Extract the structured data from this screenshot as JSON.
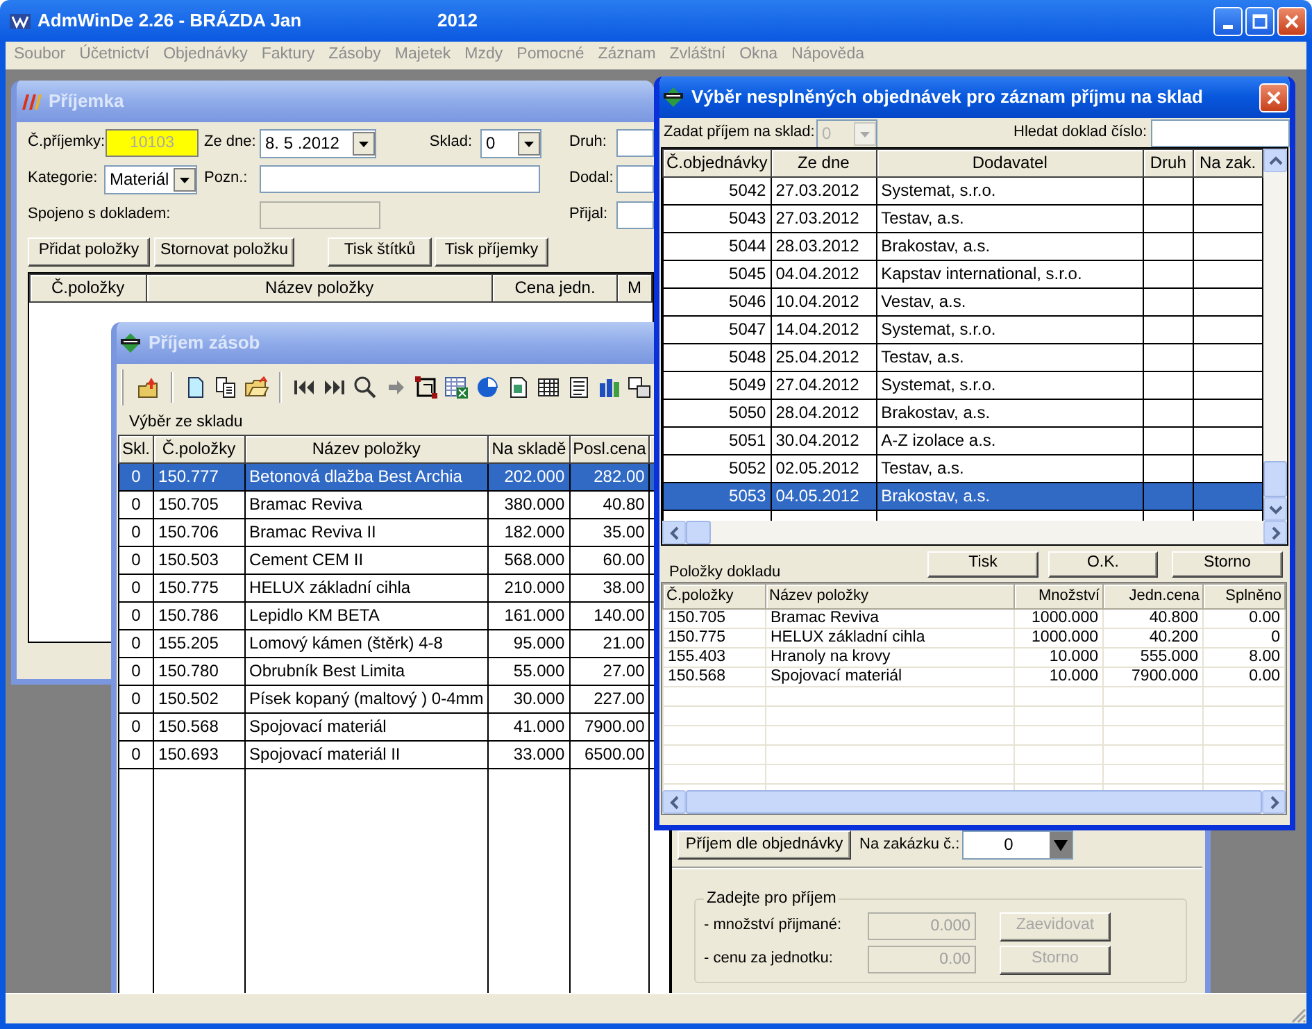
{
  "app_window": {
    "title": "AdmWinDe 2.26 - BRÁZDA Jan",
    "year": "2012"
  },
  "menu": [
    {
      "label": "Soubor",
      "disabled": true
    },
    {
      "label": "Účetnictví",
      "disabled": true
    },
    {
      "label": "Objednávky",
      "disabled": true
    },
    {
      "label": "Faktury",
      "disabled": true
    },
    {
      "label": "Zásoby",
      "disabled": true
    },
    {
      "label": "Majetek",
      "disabled": true
    },
    {
      "label": "Mzdy",
      "disabled": true
    },
    {
      "label": "Pomocné",
      "disabled": true
    },
    {
      "label": "Záznam",
      "disabled": true
    },
    {
      "label": "Zvláštní",
      "disabled": true
    },
    {
      "label": "Okna",
      "disabled": true
    },
    {
      "label": "Nápověda",
      "disabled": true
    }
  ],
  "receipt_window": {
    "title": "Příjemka",
    "active": false,
    "receipt_number": {
      "label": "Č.příjemky:",
      "value": "10103"
    },
    "date": {
      "label": "Ze dne:",
      "value": "8. 5 .2012"
    },
    "warehouse": {
      "label": "Sklad:",
      "value": "0"
    },
    "document_type": {
      "label": "Druh:"
    },
    "category": {
      "label": "Kategorie:",
      "value": "Materiál"
    },
    "note": {
      "label": "Pozn.:"
    },
    "supplier": {
      "label": "Dodal:"
    },
    "linked_document": {
      "label": "Spojeno s dokladem:",
      "disabled": true
    },
    "received_by": {
      "label": "Přijal:"
    },
    "buttons": [
      "Přidat položky",
      "Stornovat položku",
      "Tisk štítků",
      "Tisk příjemky"
    ],
    "table": {
      "columns": [
        "Č.položky",
        "Název položky",
        "Cena jedn.",
        "M"
      ]
    }
  },
  "stock_window": {
    "title": "Příjem zásob",
    "active": false,
    "section_label": "Výběr ze skladu",
    "table": {
      "columns": [
        "Skl.",
        "Č.položky",
        "Název položky",
        "Na skladě",
        "Posl.cena"
      ],
      "rows": [
        {
          "cells": [
            "0",
            "150.777",
            "Betonová dlažba Best Archia",
            "202.000",
            "282.00"
          ],
          "selected": true
        },
        {
          "cells": [
            "0",
            "150.705",
            "Bramac Reviva",
            "380.000",
            "40.80"
          ],
          "selected": false
        },
        {
          "cells": [
            "0",
            "150.706",
            "Bramac Reviva II",
            "182.000",
            "35.00"
          ],
          "selected": false
        },
        {
          "cells": [
            "0",
            "150.503",
            "Cement CEM II",
            "568.000",
            "60.00"
          ],
          "selected": false
        },
        {
          "cells": [
            "0",
            "150.775",
            "HELUX základní cihla",
            "210.000",
            "38.00"
          ],
          "selected": false
        },
        {
          "cells": [
            "0",
            "150.786",
            "Lepidlo KM BETA",
            "161.000",
            "140.00"
          ],
          "selected": false
        },
        {
          "cells": [
            "0",
            "155.205",
            "Lomový kámen (štěrk) 4-8",
            "95.000",
            "21.00"
          ],
          "selected": false
        },
        {
          "cells": [
            "0",
            "150.780",
            "Obrubník Best Limita",
            "55.000",
            "27.00"
          ],
          "selected": false
        },
        {
          "cells": [
            "0",
            "150.502",
            "Písek kopaný (maltový ) 0-4mm",
            "30.000",
            "227.00"
          ],
          "selected": false
        },
        {
          "cells": [
            "0",
            "150.568",
            "Spojovací materiál",
            "41.000",
            "7900.00"
          ],
          "selected": false
        },
        {
          "cells": [
            "0",
            "150.693",
            "Spojovací materiál II",
            "33.000",
            "6500.00"
          ],
          "selected": false
        }
      ]
    },
    "order_receipt_button": "Příjem dle objednávky",
    "job": {
      "label": "Na zakázku č.:",
      "value": "0"
    },
    "entry_group": {
      "title": "Zadejte pro příjem",
      "rows": [
        {
          "label": "- množství přijmané:",
          "value": "0.000",
          "button": "Zaevidovat",
          "disabled": true
        },
        {
          "label": "- cenu za jednotku:",
          "value": "0.00",
          "button": "Storno",
          "disabled": true
        }
      ]
    }
  },
  "order_dialog": {
    "title": "Výběr nesplněných objednávek pro záznam příjmu na sklad",
    "active": true,
    "target_warehouse": {
      "label": "Zadat příjem na sklad:",
      "value": "0",
      "disabled": true
    },
    "search": {
      "label": "Hledat doklad číslo:"
    },
    "orders": {
      "columns": [
        "Č.objednávky",
        "Ze dne",
        "Dodavatel",
        "Druh",
        "Na zak."
      ],
      "rows": [
        {
          "cells": [
            "5042",
            "27.03.2012",
            "Systemat, s.r.o."
          ],
          "selected": false
        },
        {
          "cells": [
            "5043",
            "27.03.2012",
            "Testav, a.s."
          ],
          "selected": false
        },
        {
          "cells": [
            "5044",
            "28.03.2012",
            "Brakostav, a.s."
          ],
          "selected": false
        },
        {
          "cells": [
            "5045",
            "04.04.2012",
            "Kapstav international, s.r.o."
          ],
          "selected": false
        },
        {
          "cells": [
            "5046",
            "10.04.2012",
            "Vestav, a.s."
          ],
          "selected": false
        },
        {
          "cells": [
            "5047",
            "14.04.2012",
            "Systemat, s.r.o."
          ],
          "selected": false
        },
        {
          "cells": [
            "5048",
            "25.04.2012",
            "Testav, a.s."
          ],
          "selected": false
        },
        {
          "cells": [
            "5049",
            "27.04.2012",
            "Systemat, s.r.o."
          ],
          "selected": false
        },
        {
          "cells": [
            "5050",
            "28.04.2012",
            "Brakostav, a.s."
          ],
          "selected": false
        },
        {
          "cells": [
            "5051",
            "30.04.2012",
            "A-Z izolace a.s."
          ],
          "selected": false
        },
        {
          "cells": [
            "5052",
            "02.05.2012",
            "Testav, a.s."
          ],
          "selected": false
        },
        {
          "cells": [
            "5053",
            "04.05.2012",
            "Brakostav, a.s."
          ],
          "selected": true
        }
      ]
    },
    "items_label": "Položky dokladu",
    "buttons": [
      "Tisk",
      "O.K.",
      "Storno"
    ],
    "items": {
      "columns": [
        "Č.položky",
        "Název položky",
        "Množství",
        "Jedn.cena",
        "Splněno"
      ],
      "rows": [
        {
          "cells": [
            "150.705",
            "Bramac Reviva",
            "1000.000",
            "40.800",
            "0.00"
          ]
        },
        {
          "cells": [
            "150.775",
            "HELUX základní cihla",
            "1000.000",
            "40.200",
            "0"
          ]
        },
        {
          "cells": [
            "155.403",
            "Hranoly na krovy",
            "10.000",
            "555.000",
            "8.00"
          ]
        },
        {
          "cells": [
            "150.568",
            "Spojovací materiál",
            "10.000",
            "7900.000",
            "0.00"
          ]
        }
      ]
    }
  }
}
